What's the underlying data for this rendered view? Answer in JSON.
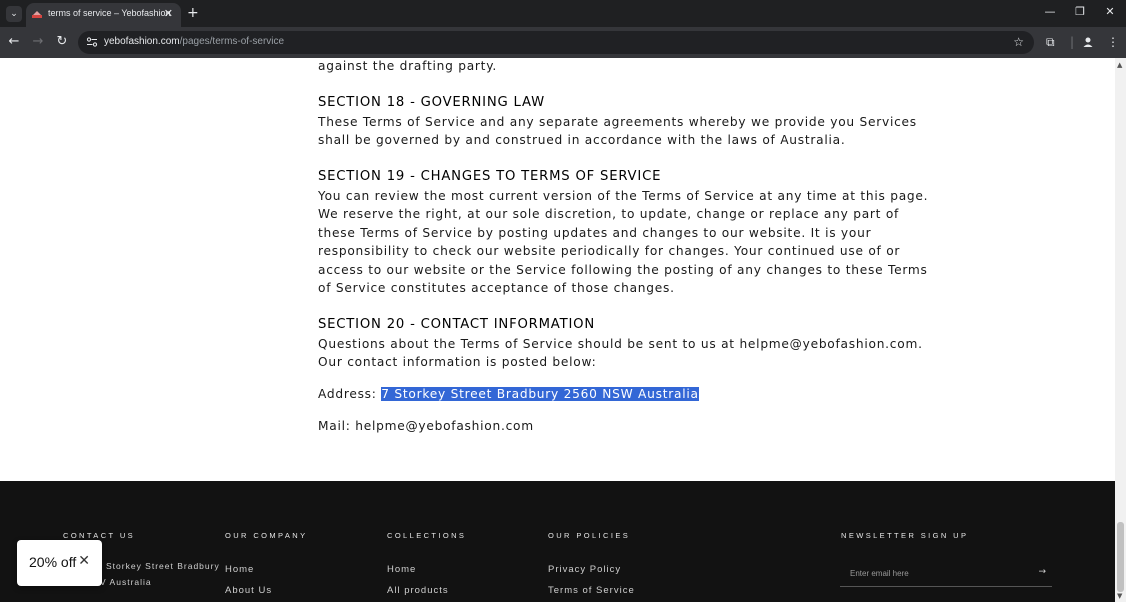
{
  "browser": {
    "tab_title": "terms of service – Yebofashion",
    "url_host": "yebofashion.com",
    "url_path": "/pages/terms-of-service"
  },
  "content": {
    "intro_tail": "against the drafting party.",
    "s18_heading": "SECTION 18 - GOVERNING LAW",
    "s18_lines": [
      "These Terms of Service and any separate agreements whereby we provide you Services",
      "shall be governed by and construed in accordance with the laws of Australia."
    ],
    "s19_heading": "SECTION 19 - CHANGES TO TERMS OF SERVICE",
    "s19_lines": [
      "You can review the most current version of the Terms of Service at any time at this page.",
      "We reserve the right, at our sole discretion, to update, change or replace any part of",
      "these Terms of Service by posting updates and changes to our website. It is your",
      "responsibility to check our website periodically for changes. Your continued use of or",
      "access to our website or the Service following the posting of any changes to these Terms",
      "of Service constitutes acceptance of those changes."
    ],
    "s20_heading": "SECTION 20 - CONTACT INFORMATION",
    "s20_lines": [
      "Questions about the Terms of Service should be sent to us at helpme@yebofashion.com.",
      "Our contact information is posted below:"
    ],
    "address_label": "Address: ",
    "address_value": "7 Storkey Street Bradbury 2560 NSW Australia",
    "mail": "Mail: helpme@yebofashion.com"
  },
  "footer": {
    "contact_heading": "CONTACT US",
    "contact_line1": "Storkey Street Bradbury",
    "contact_line2": "V Australia",
    "company_heading": "OUR COMPANY",
    "company_links": [
      "Home",
      "About Us"
    ],
    "collections_heading": "COLLECTIONS",
    "collections_links": [
      "Home",
      "All products"
    ],
    "policies_heading": "OUR POLICIES",
    "policies_links": [
      "Privacy Policy",
      "Terms of Service"
    ],
    "newsletter_heading": "NEWSLETTER SIGN UP",
    "email_placeholder": "Enter email here"
  },
  "promo": {
    "label": "20% off"
  },
  "colors": {
    "highlight": "#3367d6",
    "footer_bg": "#121212",
    "chrome_bg": "#35363a"
  }
}
